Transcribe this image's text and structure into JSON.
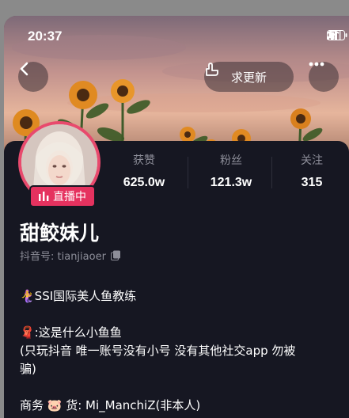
{
  "status_bar": {
    "time": "20:37"
  },
  "header": {
    "update_button_label": "求更新"
  },
  "profile": {
    "live_badge": "直播中",
    "name": "甜鲛妹儿",
    "douyin_id": "抖音号: tianjiaoer",
    "stats": [
      {
        "label": "获赞",
        "value": "625.0w"
      },
      {
        "label": "粉丝",
        "value": "121.3w"
      },
      {
        "label": "关注",
        "value": "315"
      }
    ],
    "bio_lines": [
      "🧜‍♀️SSI国际美人鱼教练",
      "🧣:这是什么小鱼鱼",
      "(只玩抖音 唯一账号没有小号 没有其他社交app 勿被",
      "骗)",
      "商务 🐷 货: Mi_ManchiZ(非本人)"
    ]
  },
  "colors": {
    "background": "#161722",
    "live_pink": "#e5325f",
    "muted_text": "#8d8e99"
  }
}
